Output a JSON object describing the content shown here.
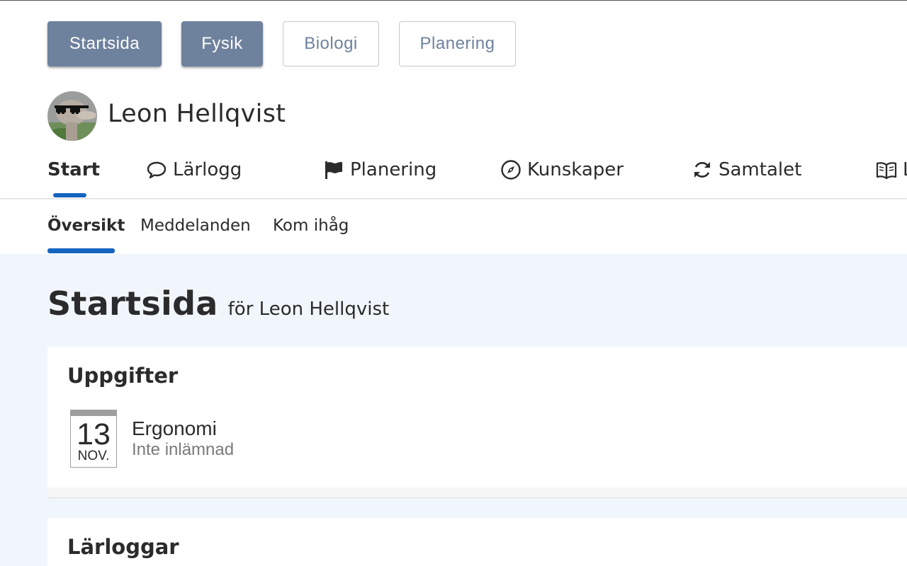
{
  "subject_buttons": [
    {
      "label": "Startsida",
      "style": "filled"
    },
    {
      "label": "Fysik",
      "style": "filled"
    },
    {
      "label": "Biologi",
      "style": "outline"
    },
    {
      "label": "Planering",
      "style": "outline"
    }
  ],
  "profile": {
    "name": "Leon Hellqvist"
  },
  "main_nav": {
    "active": "Start",
    "items": [
      {
        "label": "Start",
        "icon": ""
      },
      {
        "label": "Lärlogg",
        "icon": "speech-bubble-icon"
      },
      {
        "label": "Planering",
        "icon": "flag-icon"
      },
      {
        "label": "Kunskaper",
        "icon": "compass-icon"
      },
      {
        "label": "Samtalet",
        "icon": "refresh-icon"
      },
      {
        "label": "L",
        "icon": "book-icon"
      }
    ]
  },
  "sub_nav": {
    "active": "Översikt",
    "items": [
      "Översikt",
      "Meddelanden",
      "Kom ihåg"
    ]
  },
  "page": {
    "title": "Startsida",
    "subtitle": "för Leon Hellqvist"
  },
  "tasks_card": {
    "title": "Uppgifter",
    "items": [
      {
        "day": "13",
        "month": "NOV.",
        "title": "Ergonomi",
        "status": "Inte inlämnad"
      }
    ]
  },
  "logs_card": {
    "title": "Lärloggar"
  },
  "colors": {
    "accent": "#1565c0",
    "button_filled": "#6e819d",
    "page_background": "#f1f6fc"
  }
}
